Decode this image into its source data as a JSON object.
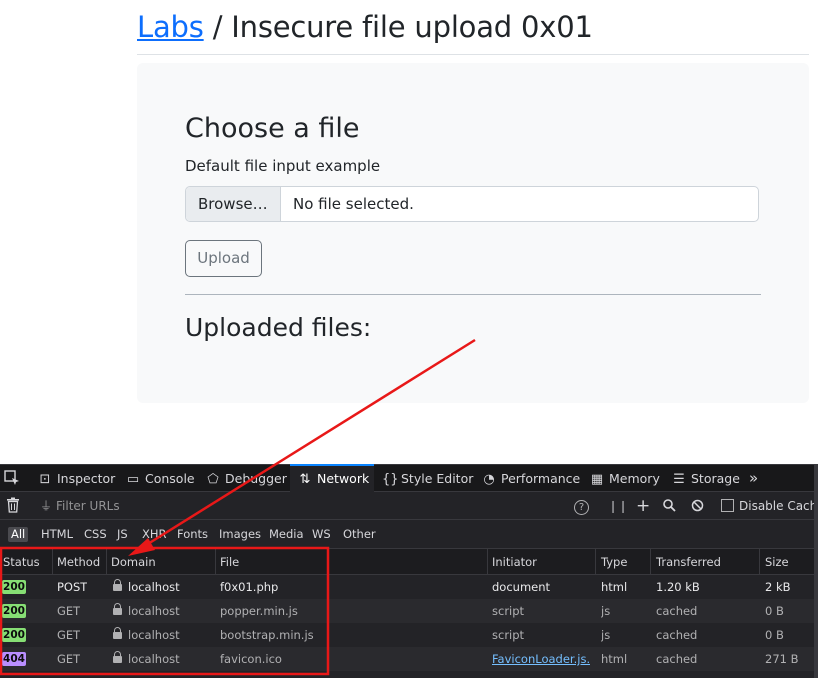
{
  "page": {
    "breadcrumb_link": "Labs",
    "breadcrumb_sep": "/",
    "title": "Insecure file upload 0x01",
    "section_title": "Choose a file",
    "input_label": "Default file input example",
    "browse_label": "Browse…",
    "no_file_text": "No file selected.",
    "upload_label": "Upload",
    "uploaded_title": "Uploaded files:"
  },
  "devtools": {
    "tabs": [
      {
        "label": "Inspector",
        "icon": "inspector-icon"
      },
      {
        "label": "Console",
        "icon": "console-icon"
      },
      {
        "label": "Debugger",
        "icon": "debugger-icon"
      },
      {
        "label": "Network",
        "icon": "network-icon"
      },
      {
        "label": "Style Editor",
        "icon": "style-editor-icon"
      },
      {
        "label": "Performance",
        "icon": "performance-icon"
      },
      {
        "label": "Memory",
        "icon": "memory-icon"
      },
      {
        "label": "Storage",
        "icon": "storage-icon"
      }
    ],
    "active_tab": "Network",
    "filter_placeholder": "Filter URLs",
    "disable_cache_label": "Disable Cache",
    "filters": [
      "All",
      "HTML",
      "CSS",
      "JS",
      "XHR",
      "Fonts",
      "Images",
      "Media",
      "WS",
      "Other"
    ],
    "active_filter": "All",
    "columns": [
      "Status",
      "Method",
      "Domain",
      "File",
      "Initiator",
      "Type",
      "Transferred",
      "Size"
    ],
    "rows": [
      {
        "status": "200",
        "method": "POST",
        "domain": "localhost",
        "file": "f0x01.php",
        "initiator": "document",
        "type": "html",
        "transferred": "1.20 kB",
        "size": "2 kB"
      },
      {
        "status": "200",
        "method": "GET",
        "domain": "localhost",
        "file": "popper.min.js",
        "initiator": "script",
        "type": "js",
        "transferred": "cached",
        "size": "0 B"
      },
      {
        "status": "200",
        "method": "GET",
        "domain": "localhost",
        "file": "bootstrap.min.js",
        "initiator": "script",
        "type": "js",
        "transferred": "cached",
        "size": "0 B"
      },
      {
        "status": "404",
        "method": "GET",
        "domain": "localhost",
        "file": "favicon.ico",
        "initiator": "FaviconLoader.js…",
        "type": "html",
        "transferred": "cached",
        "size": "271 B"
      }
    ]
  },
  "colors": {
    "link": "#0d6efd",
    "status_ok": "#86de74",
    "status_not_found": "#b98eff",
    "annotation": "#e81818",
    "active_tab_accent": "#0a84ff"
  }
}
